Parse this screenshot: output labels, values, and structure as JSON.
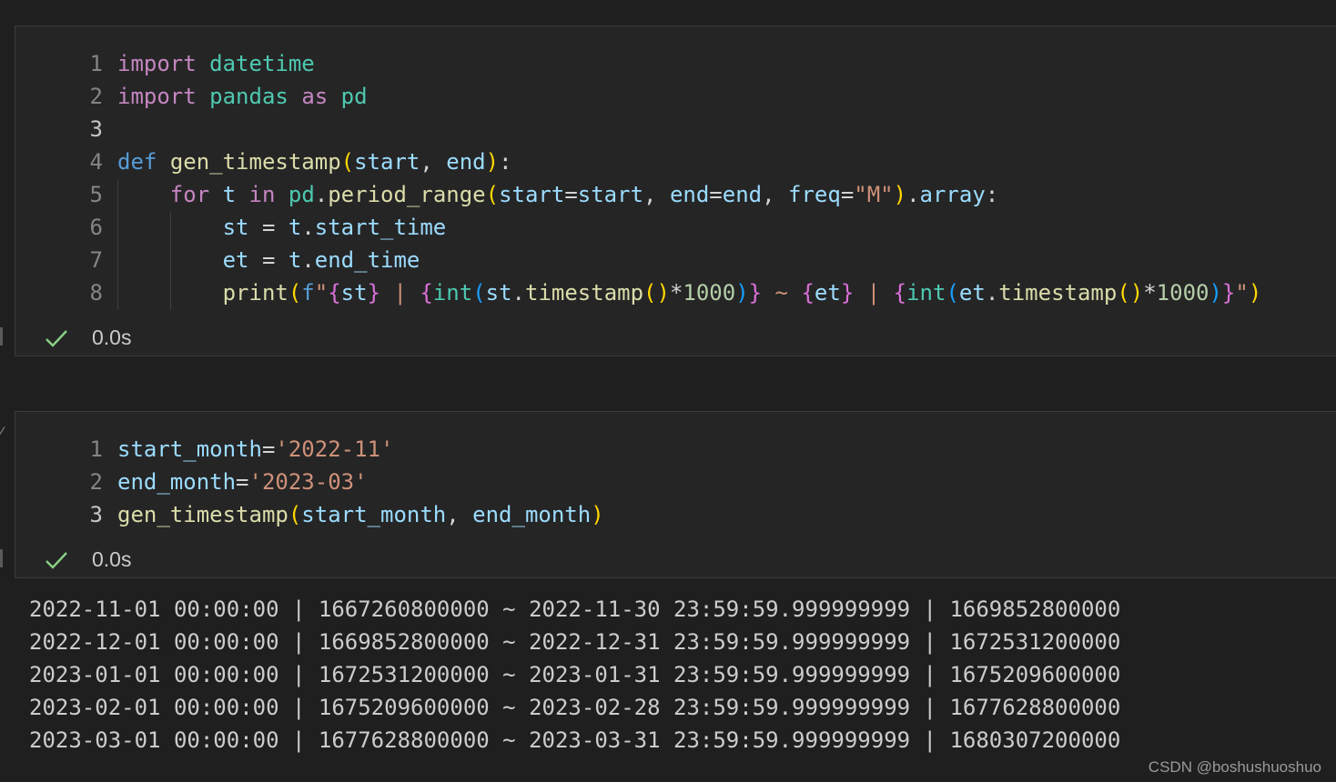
{
  "cell1": {
    "lines": [
      {
        "num": "1",
        "tokens": [
          [
            "kw",
            "import"
          ],
          [
            "",
            " "
          ],
          [
            "mod",
            "datetime"
          ]
        ]
      },
      {
        "num": "2",
        "tokens": [
          [
            "kw",
            "import"
          ],
          [
            "",
            " "
          ],
          [
            "mod",
            "pandas"
          ],
          [
            "",
            " "
          ],
          [
            "kw",
            "as"
          ],
          [
            "",
            " "
          ],
          [
            "mod",
            "pd"
          ]
        ]
      },
      {
        "num": "3",
        "tokens": []
      },
      {
        "num": "4",
        "tokens": [
          [
            "def",
            "def"
          ],
          [
            "",
            " "
          ],
          [
            "fn",
            "gen_timestamp"
          ],
          [
            "p1",
            "("
          ],
          [
            "var",
            "start"
          ],
          [
            "",
            ", "
          ],
          [
            "var",
            "end"
          ],
          [
            "p1",
            ")"
          ],
          [
            "",
            ":"
          ]
        ]
      },
      {
        "num": "5",
        "tokens": [
          [
            "",
            "    "
          ],
          [
            "kw",
            "for"
          ],
          [
            "",
            " "
          ],
          [
            "var",
            "t"
          ],
          [
            "",
            " "
          ],
          [
            "kw",
            "in"
          ],
          [
            "",
            " "
          ],
          [
            "mod",
            "pd"
          ],
          [
            "",
            "."
          ],
          [
            "fn",
            "period_range"
          ],
          [
            "p1",
            "("
          ],
          [
            "var",
            "start"
          ],
          [
            "",
            "="
          ],
          [
            "var",
            "start"
          ],
          [
            "",
            ", "
          ],
          [
            "var",
            "end"
          ],
          [
            "",
            "="
          ],
          [
            "var",
            "end"
          ],
          [
            "",
            ", "
          ],
          [
            "var",
            "freq"
          ],
          [
            "",
            "="
          ],
          [
            "str",
            "\"M\""
          ],
          [
            "p1",
            ")"
          ],
          [
            "",
            "."
          ],
          [
            "var",
            "array"
          ],
          [
            "",
            ":"
          ]
        ]
      },
      {
        "num": "6",
        "tokens": [
          [
            "",
            "        "
          ],
          [
            "var",
            "st"
          ],
          [
            "",
            ""
          ],
          [
            "",
            ""
          ],
          [
            "",
            " = "
          ],
          [
            "var",
            "t"
          ],
          [
            "",
            "."
          ],
          [
            "var",
            "start_time"
          ]
        ]
      },
      {
        "num": "7",
        "tokens": [
          [
            "",
            "        "
          ],
          [
            "var",
            "et"
          ],
          [
            "",
            " = "
          ],
          [
            "var",
            "t"
          ],
          [
            "",
            "."
          ],
          [
            "var",
            "end_time"
          ]
        ]
      },
      {
        "num": "8",
        "tokens": [
          [
            "",
            "        "
          ],
          [
            "fn",
            "print"
          ],
          [
            "p1",
            "("
          ],
          [
            "def",
            "f"
          ],
          [
            "str",
            "\""
          ],
          [
            "p2",
            "{"
          ],
          [
            "var",
            "st"
          ],
          [
            "p2",
            "}"
          ],
          [
            "str",
            " | "
          ],
          [
            "p2",
            "{"
          ],
          [
            "mod",
            "int"
          ],
          [
            "p3",
            "("
          ],
          [
            "var",
            "st"
          ],
          [
            "",
            "."
          ],
          [
            "fn",
            "timestamp"
          ],
          [
            "p1",
            "()"
          ],
          [
            "",
            "*"
          ],
          [
            "num",
            "1000"
          ],
          [
            "p3",
            ")"
          ],
          [
            "p2",
            "}"
          ],
          [
            "str",
            " ~ "
          ],
          [
            "p2",
            "{"
          ],
          [
            "var",
            "et"
          ],
          [
            "p2",
            "}"
          ],
          [
            "str",
            " | "
          ],
          [
            "p2",
            "{"
          ],
          [
            "mod",
            "int"
          ],
          [
            "p3",
            "("
          ],
          [
            "var",
            "et"
          ],
          [
            "",
            "."
          ],
          [
            "fn",
            "timestamp"
          ],
          [
            "p1",
            "()"
          ],
          [
            "",
            "*"
          ],
          [
            "num",
            "1000"
          ],
          [
            "p3",
            ")"
          ],
          [
            "p2",
            "}"
          ],
          [
            "str",
            "\""
          ],
          [
            "p1",
            ")"
          ]
        ]
      }
    ],
    "active_line": 2,
    "exec_time": "0.0s"
  },
  "cell2": {
    "lines": [
      {
        "num": "1",
        "tokens": [
          [
            "var",
            "start_month"
          ],
          [
            "",
            "="
          ],
          [
            "str",
            "'2022-11'"
          ]
        ]
      },
      {
        "num": "2",
        "tokens": [
          [
            "var",
            "end_month"
          ],
          [
            "",
            "="
          ],
          [
            "str",
            "'2023-03'"
          ]
        ]
      },
      {
        "num": "3",
        "tokens": [
          [
            "fn",
            "gen_timestamp"
          ],
          [
            "p1",
            "("
          ],
          [
            "var",
            "start_month"
          ],
          [
            "",
            ", "
          ],
          [
            "var",
            "end_month"
          ],
          [
            "p1",
            ")"
          ]
        ]
      }
    ],
    "active_line": 2,
    "exec_time": "0.0s"
  },
  "output": [
    "2022-11-01 00:00:00 | 1667260800000 ~ 2022-11-30 23:59:59.999999999 | 1669852800000",
    "2022-12-01 00:00:00 | 1669852800000 ~ 2022-12-31 23:59:59.999999999 | 1672531200000",
    "2023-01-01 00:00:00 | 1672531200000 ~ 2023-01-31 23:59:59.999999999 | 1675209600000",
    "2023-02-01 00:00:00 | 1675209600000 ~ 2023-02-28 23:59:59.999999999 | 1677628800000",
    "2023-03-01 00:00:00 | 1677628800000 ~ 2023-03-31 23:59:59.999999999 | 1680307200000"
  ],
  "watermark": "CSDN @boshushuoshuo",
  "icons": {
    "status": "check-icon"
  },
  "colors": {
    "success": "#89d185"
  }
}
